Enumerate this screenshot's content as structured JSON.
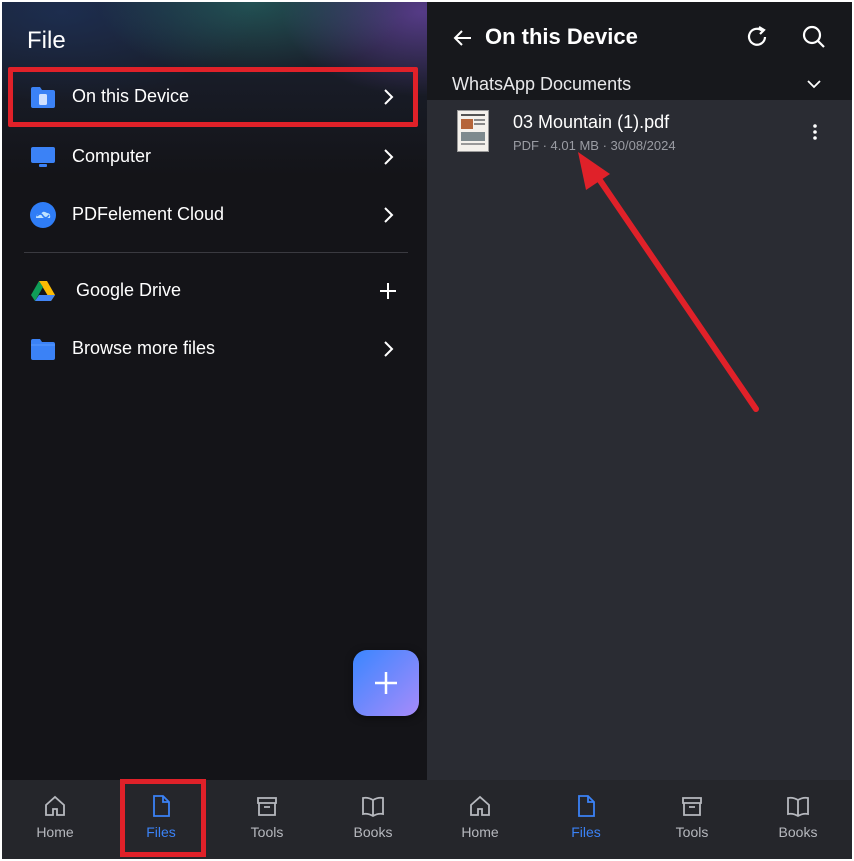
{
  "left_panel": {
    "title": "File",
    "menu": [
      {
        "label": "On this Device",
        "icon": "device-folder-icon",
        "trailing": "chevron-right-icon"
      },
      {
        "label": "Computer",
        "icon": "computer-icon",
        "trailing": "chevron-right-icon"
      },
      {
        "label": "PDFelement Cloud",
        "icon": "cloud-icon",
        "trailing": "chevron-right-icon"
      },
      {
        "label": "Google Drive",
        "icon": "google-drive-icon",
        "trailing": "plus-icon"
      },
      {
        "label": "Browse more files",
        "icon": "folder-icon",
        "trailing": "chevron-right-icon"
      }
    ],
    "fab_icon": "plus-icon"
  },
  "right_panel": {
    "title": "On this Device",
    "folder": "WhatsApp Documents",
    "file": {
      "name": "03 Mountain (1).pdf",
      "meta": "PDF · 4.01 MB · 30/08/2024"
    }
  },
  "bottom_nav": [
    {
      "label": "Home",
      "icon": "home-icon"
    },
    {
      "label": "Files",
      "icon": "file-icon",
      "active": true
    },
    {
      "label": "Tools",
      "icon": "archive-box-icon"
    },
    {
      "label": "Books",
      "icon": "book-icon"
    }
  ],
  "colors": {
    "accent": "#3b82f6",
    "annotation": "#e02129",
    "left_bg": "#141418",
    "right_bg": "#2a2c33"
  }
}
